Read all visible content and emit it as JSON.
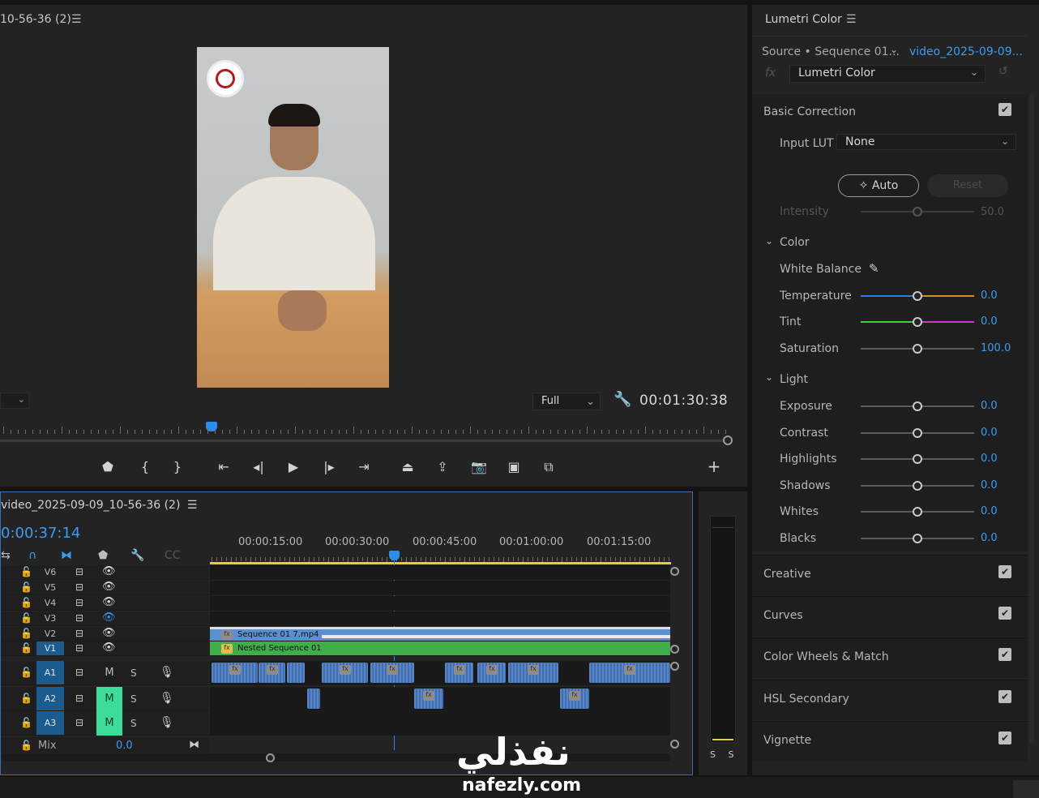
{
  "program": {
    "title": "10-56-36 (2)",
    "menu_icon": "☰",
    "resolution": "Full",
    "duration": "00:01:30:38"
  },
  "timeline": {
    "title": "video_2025-09-09_10-56-36 (2)",
    "menu_icon": "☰",
    "timecode": "0:00:37:14",
    "ruler_labels": [
      "00:00:15:00",
      "00:00:30:00",
      "00:00:45:00",
      "00:01:00:00",
      "00:01:15:00"
    ],
    "video_tracks": [
      {
        "label": "V6",
        "active": false,
        "eye": "on"
      },
      {
        "label": "V5",
        "active": false,
        "eye": "on"
      },
      {
        "label": "V4",
        "active": false,
        "eye": "on"
      },
      {
        "label": "V3",
        "active": false,
        "eye": "off"
      },
      {
        "label": "V2",
        "active": false,
        "eye": "on"
      },
      {
        "label": "V1",
        "active": true,
        "eye": "on"
      }
    ],
    "clips": {
      "v2": "Sequence 01  7.mp4",
      "v1": "Nested Sequence 01",
      "fx_label": "fx"
    },
    "audio_tracks": [
      {
        "label": "A1",
        "m": "M",
        "m_on": false,
        "s": "S"
      },
      {
        "label": "A2",
        "m": "M",
        "m_on": true,
        "s": "S"
      },
      {
        "label": "A3",
        "m": "M",
        "m_on": true,
        "s": "S"
      }
    ],
    "mix_label": "Mix",
    "mix_value": "0.0"
  },
  "meter": {
    "labels": "S S"
  },
  "lumetri": {
    "panel_title": "Lumetri Color",
    "menu_icon": "☰",
    "source": "Source • Sequence 01...",
    "clip": "video_2025-09-09...",
    "fx": "fx",
    "effect": "Lumetri Color",
    "basic_correction": "Basic Correction",
    "input_lut_label": "Input LUT",
    "input_lut_value": "None",
    "auto": "Auto",
    "reset": "Reset",
    "intensity": {
      "label": "Intensity",
      "value": "50.0"
    },
    "color_section": "Color",
    "white_balance": "White Balance",
    "color_sliders": [
      {
        "label": "Temperature",
        "value": "0.0"
      },
      {
        "label": "Tint",
        "value": "0.0"
      },
      {
        "label": "Saturation",
        "value": "100.0"
      }
    ],
    "light_section": "Light",
    "light_sliders": [
      {
        "label": "Exposure",
        "value": "0.0"
      },
      {
        "label": "Contrast",
        "value": "0.0"
      },
      {
        "label": "Highlights",
        "value": "0.0"
      },
      {
        "label": "Shadows",
        "value": "0.0"
      },
      {
        "label": "Whites",
        "value": "0.0"
      },
      {
        "label": "Blacks",
        "value": "0.0"
      }
    ],
    "sections": [
      "Creative",
      "Curves",
      "Color Wheels & Match",
      "HSL Secondary",
      "Vignette"
    ]
  },
  "watermark": {
    "arabic": "نفذلي",
    "latin": "nafezly.com"
  },
  "colors": {
    "accent": "#2d8ceb",
    "mute_on": "#3ddc98",
    "v1_clip": "#3fae4a",
    "workbar": "#e7d21d"
  }
}
